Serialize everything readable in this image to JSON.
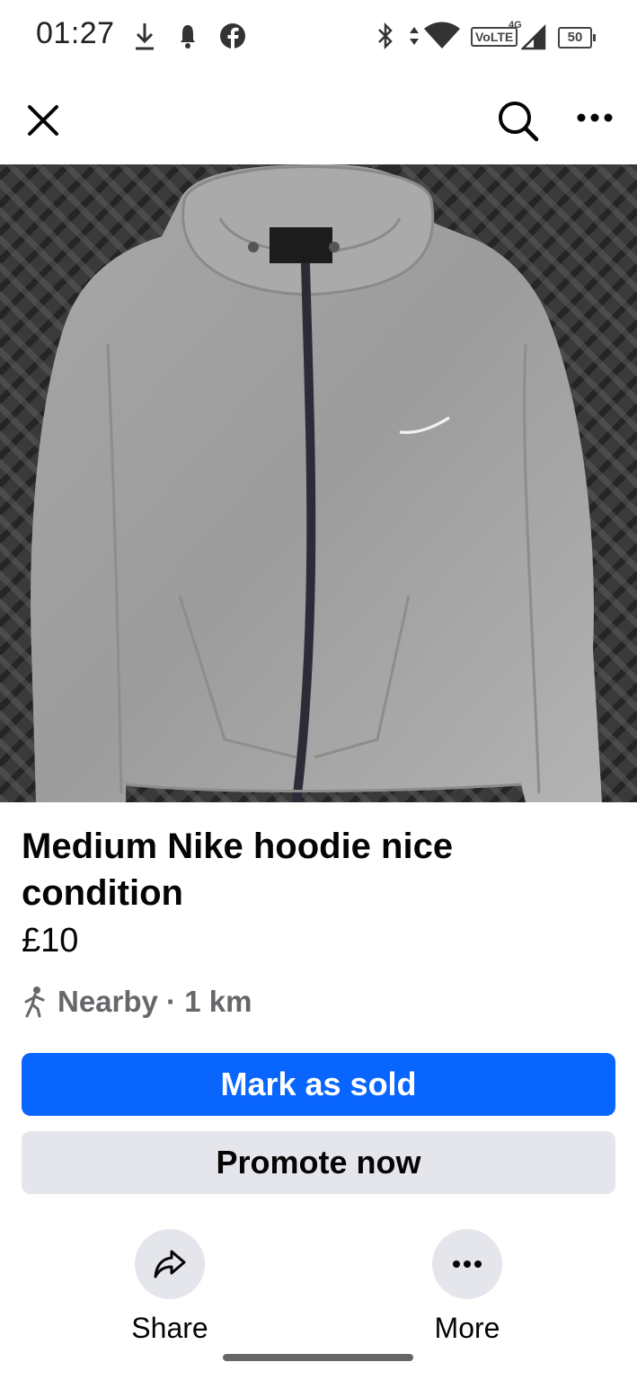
{
  "status_bar": {
    "time": "01:27",
    "icons": [
      "download-icon",
      "notification-icon",
      "facebook-icon",
      "bluetooth-icon",
      "data-arrows-icon",
      "wifi-icon",
      "signal-icon"
    ],
    "volte": "VoLTE",
    "network": "4G",
    "battery": "50"
  },
  "app_bar": {
    "icons": [
      "close-icon",
      "search-icon",
      "more-icon"
    ]
  },
  "listing": {
    "title": "Medium Nike hoodie nice condition",
    "price": "£10",
    "location": "Nearby · 1 km",
    "location_icon": "walking-person-icon"
  },
  "actions": {
    "mark_sold": "Mark as sold",
    "promote": "Promote now",
    "share_label": "Share",
    "more_label": "More"
  },
  "colors": {
    "primary": "#0866ff",
    "secondary_bg": "#e4e6eb",
    "muted_text": "#65676b"
  }
}
